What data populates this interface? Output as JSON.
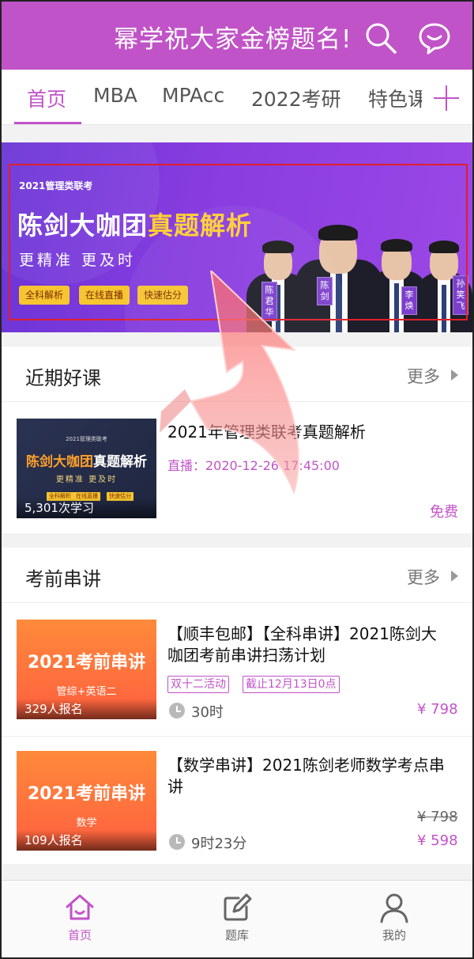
{
  "header": {
    "title": "幂学祝大家金榜题名!",
    "search_icon": "search-icon",
    "message_icon": "chat-bubble-icon",
    "bg_color": "#c153c8"
  },
  "tabs": [
    {
      "label": "首页",
      "active": true
    },
    {
      "label": "MBA",
      "active": false
    },
    {
      "label": "MPAcc",
      "active": false
    },
    {
      "label": "2022考研",
      "active": false
    },
    {
      "label": "特色课",
      "active": false
    }
  ],
  "tabs_more_icon": "plus-icon",
  "banner": {
    "tag": "2021管理类联考",
    "headline_a": "陈剑大咖团",
    "headline_b": "真题解析",
    "subline": "更精准 更及时",
    "buttons": [
      "全科解析",
      "在线直播",
      "快速估分"
    ],
    "teachers": [
      "陈君华",
      "陈剑",
      "李焕",
      "孙笑飞"
    ]
  },
  "recent": {
    "title": "近期好课",
    "more": "更多",
    "course": {
      "thumb_tag": "2021管理类联考",
      "thumb_headline_a": "陈剑大咖团",
      "thumb_headline_b": "真题解析",
      "thumb_sub": "更精准 更及时",
      "thumb_buttons": [
        "全科解析",
        "在线直播",
        "快速估分"
      ],
      "learn_count": "5,301次学习",
      "title": "2021年管理类联考真题解析",
      "live_time": "直播：2020-12-26 17:45:00",
      "price": "免费"
    }
  },
  "prelecture": {
    "title": "考前串讲",
    "more": "更多",
    "courses": [
      {
        "thumb_headline": "2021考前串讲",
        "thumb_sub": "管综+英语二",
        "signups": "329人报名",
        "title": "【顺丰包邮】【全科串讲】2021陈剑大咖团考前串讲扫荡计划",
        "badges": [
          "双十二活动",
          "截止12月13日0点"
        ],
        "duration": "30时",
        "price": "¥ 798"
      },
      {
        "thumb_headline": "2021考前串讲",
        "thumb_sub": "数学",
        "signups": "109人报名",
        "title": "【数学串讲】2021陈剑老师数学考点串讲",
        "duration": "9时23分",
        "old_price": "¥ 798",
        "price": "¥ 598"
      }
    ]
  },
  "bottom_nav": [
    {
      "label": "首页",
      "icon": "home-icon",
      "active": true
    },
    {
      "label": "题库",
      "icon": "edit-icon",
      "active": false
    },
    {
      "label": "我的",
      "icon": "user-icon",
      "active": false
    }
  ],
  "accent_color": "#c153c8"
}
